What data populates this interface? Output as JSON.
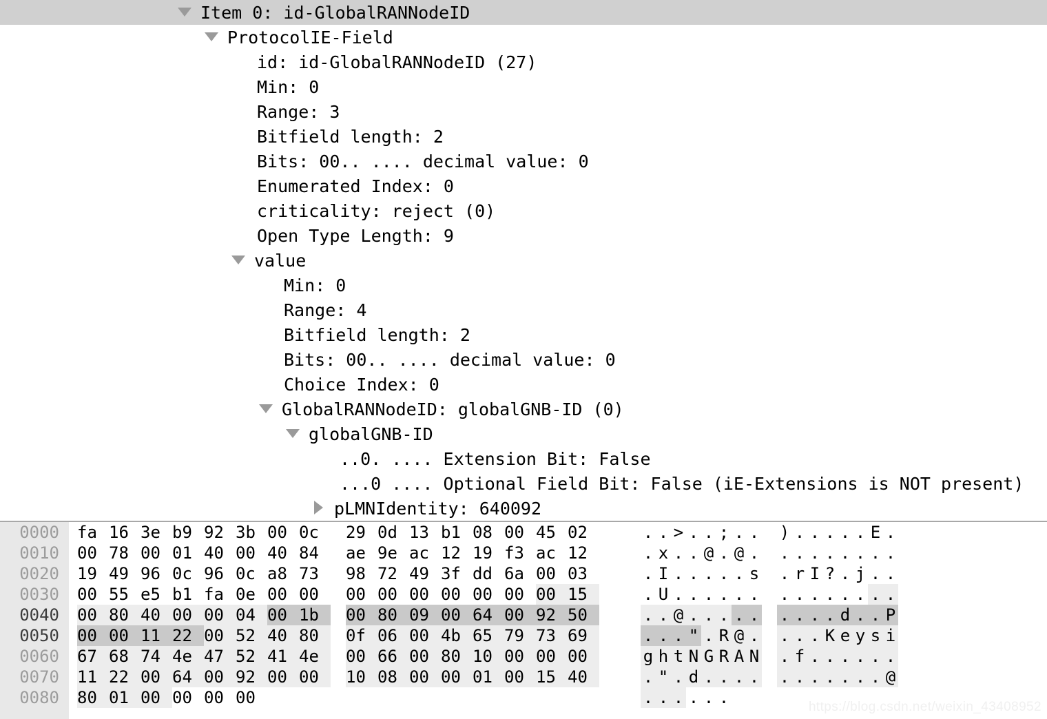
{
  "detail_tree": {
    "rows": [
      {
        "indent": "ind0",
        "twisty": "open",
        "text": "Item 0: id-GlobalRANNodeID",
        "selected": true
      },
      {
        "indent": "ind1",
        "twisty": "open",
        "text": "ProtocolIE-Field",
        "selected": false
      },
      {
        "indent": "ind2",
        "twisty": "none",
        "text": "id: id-GlobalRANNodeID (27)",
        "selected": false
      },
      {
        "indent": "ind2",
        "twisty": "none",
        "text": "Min: 0",
        "selected": false
      },
      {
        "indent": "ind2",
        "twisty": "none",
        "text": "Range: 3",
        "selected": false
      },
      {
        "indent": "ind2",
        "twisty": "none",
        "text": "Bitfield length: 2",
        "selected": false
      },
      {
        "indent": "ind2",
        "twisty": "none",
        "text": "Bits: 00.. .... decimal value: 0",
        "selected": false
      },
      {
        "indent": "ind2",
        "twisty": "none",
        "text": "Enumerated Index: 0",
        "selected": false
      },
      {
        "indent": "ind2",
        "twisty": "none",
        "text": "criticality: reject (0)",
        "selected": false
      },
      {
        "indent": "ind2",
        "twisty": "none",
        "text": "Open Type Length: 9",
        "selected": false
      },
      {
        "indent": "ind3",
        "twisty": "open",
        "text": "value",
        "selected": false
      },
      {
        "indent": "ind4",
        "twisty": "none",
        "text": "Min: 0",
        "selected": false
      },
      {
        "indent": "ind4",
        "twisty": "none",
        "text": "Range: 4",
        "selected": false
      },
      {
        "indent": "ind4",
        "twisty": "none",
        "text": "Bitfield length: 2",
        "selected": false
      },
      {
        "indent": "ind4",
        "twisty": "none",
        "text": "Bits: 00.. .... decimal value: 0",
        "selected": false
      },
      {
        "indent": "ind4",
        "twisty": "none",
        "text": "Choice Index: 0",
        "selected": false
      },
      {
        "indent": "ind5",
        "twisty": "open",
        "text": "GlobalRANNodeID: globalGNB-ID (0)",
        "selected": false
      },
      {
        "indent": "ind6",
        "twisty": "open",
        "text": "globalGNB-ID",
        "selected": false
      },
      {
        "indent": "ind7",
        "twisty": "none",
        "text": "..0. .... Extension Bit: False",
        "selected": false
      },
      {
        "indent": "ind7",
        "twisty": "none",
        "text": "...0 .... Optional Field Bit: False (iE-Extensions is NOT present)",
        "selected": false
      },
      {
        "indent": "ind8",
        "twisty": "closed",
        "text": "pLMNIdentity: 640092",
        "selected": false
      }
    ]
  },
  "hex_dump": {
    "rows": [
      {
        "offset": "0000",
        "offset_highlight": false,
        "bytes": [
          "fa",
          "16",
          "3e",
          "b9",
          "92",
          "3b",
          "00",
          "0c",
          "29",
          "0d",
          "13",
          "b1",
          "08",
          "00",
          "45",
          "02"
        ],
        "ascii": [
          ".",
          ".",
          ">",
          ".",
          ".",
          ";",
          ".",
          ".",
          ")",
          ".",
          ".",
          ".",
          ".",
          ".",
          "E",
          "."
        ],
        "hl_light_from": -1,
        "hl_light_to": -1,
        "hl_dark_from": -1,
        "hl_dark_to": -1
      },
      {
        "offset": "0010",
        "offset_highlight": false,
        "bytes": [
          "00",
          "78",
          "00",
          "01",
          "40",
          "00",
          "40",
          "84",
          "ae",
          "9e",
          "ac",
          "12",
          "19",
          "f3",
          "ac",
          "12"
        ],
        "ascii": [
          ".",
          "x",
          ".",
          ".",
          "@",
          ".",
          "@",
          ".",
          ".",
          ".",
          ".",
          ".",
          ".",
          ".",
          ".",
          "."
        ],
        "hl_light_from": -1,
        "hl_light_to": -1,
        "hl_dark_from": -1,
        "hl_dark_to": -1
      },
      {
        "offset": "0020",
        "offset_highlight": false,
        "bytes": [
          "19",
          "49",
          "96",
          "0c",
          "96",
          "0c",
          "a8",
          "73",
          "98",
          "72",
          "49",
          "3f",
          "dd",
          "6a",
          "00",
          "03"
        ],
        "ascii": [
          ".",
          "I",
          ".",
          ".",
          ".",
          ".",
          ".",
          "s",
          ".",
          "r",
          "I",
          "?",
          ".",
          "j",
          ".",
          "."
        ],
        "hl_light_from": -1,
        "hl_light_to": -1,
        "hl_dark_from": -1,
        "hl_dark_to": -1
      },
      {
        "offset": "0030",
        "offset_highlight": false,
        "bytes": [
          "00",
          "55",
          "e5",
          "b1",
          "fa",
          "0e",
          "00",
          "00",
          "00",
          "00",
          "00",
          "00",
          "00",
          "00",
          "00",
          "15"
        ],
        "ascii": [
          ".",
          "U",
          ".",
          ".",
          ".",
          ".",
          ".",
          ".",
          ".",
          ".",
          ".",
          ".",
          ".",
          ".",
          ".",
          "."
        ],
        "hl_light_from": 14,
        "hl_light_to": 15,
        "hl_dark_from": -1,
        "hl_dark_to": -1
      },
      {
        "offset": "0040",
        "offset_highlight": true,
        "bytes": [
          "00",
          "80",
          "40",
          "00",
          "00",
          "04",
          "00",
          "1b",
          "00",
          "80",
          "09",
          "00",
          "64",
          "00",
          "92",
          "50"
        ],
        "ascii": [
          ".",
          ".",
          "@",
          ".",
          ".",
          ".",
          ".",
          ".",
          ".",
          ".",
          ".",
          ".",
          "d",
          ".",
          ".",
          "P"
        ],
        "hl_light_from": 0,
        "hl_light_to": 15,
        "hl_dark_from": 6,
        "hl_dark_to": 15
      },
      {
        "offset": "0050",
        "offset_highlight": true,
        "bytes": [
          "00",
          "00",
          "11",
          "22",
          "00",
          "52",
          "40",
          "80",
          "0f",
          "06",
          "00",
          "4b",
          "65",
          "79",
          "73",
          "69"
        ],
        "ascii": [
          ".",
          ".",
          ".",
          "\"",
          ".",
          "R",
          "@",
          ".",
          ".",
          ".",
          ".",
          "K",
          "e",
          "y",
          "s",
          "i"
        ],
        "hl_light_from": 0,
        "hl_light_to": 15,
        "hl_dark_from": 0,
        "hl_dark_to": 3
      },
      {
        "offset": "0060",
        "offset_highlight": false,
        "bytes": [
          "67",
          "68",
          "74",
          "4e",
          "47",
          "52",
          "41",
          "4e",
          "00",
          "66",
          "00",
          "80",
          "10",
          "00",
          "00",
          "00"
        ],
        "ascii": [
          "g",
          "h",
          "t",
          "N",
          "G",
          "R",
          "A",
          "N",
          ".",
          "f",
          ".",
          ".",
          ".",
          ".",
          ".",
          "."
        ],
        "hl_light_from": 0,
        "hl_light_to": 15,
        "hl_dark_from": -1,
        "hl_dark_to": -1
      },
      {
        "offset": "0070",
        "offset_highlight": false,
        "bytes": [
          "11",
          "22",
          "00",
          "64",
          "00",
          "92",
          "00",
          "00",
          "10",
          "08",
          "00",
          "00",
          "01",
          "00",
          "15",
          "40"
        ],
        "ascii": [
          ".",
          "\"",
          ".",
          "d",
          ".",
          ".",
          ".",
          ".",
          ".",
          ".",
          ".",
          ".",
          ".",
          ".",
          ".",
          "@"
        ],
        "hl_light_from": 0,
        "hl_light_to": 15,
        "hl_dark_from": -1,
        "hl_dark_to": -1
      },
      {
        "offset": "0080",
        "offset_highlight": false,
        "bytes": [
          "80",
          "01",
          "00",
          "00",
          "00",
          "00"
        ],
        "ascii": [
          ".",
          ".",
          ".",
          ".",
          ".",
          "."
        ],
        "hl_light_from": 0,
        "hl_light_to": 2,
        "hl_dark_from": -1,
        "hl_dark_to": -1
      }
    ]
  },
  "watermark": {
    "text": "https://blog.csdn.net/weixin_43408952"
  },
  "colors": {
    "selection_gray": "#d0d0d0",
    "gutter_gray": "#e8e8e8",
    "highlight_light": "#ededed",
    "highlight_dark": "#c9c9c9",
    "twisty_gray": "#9a9a9a",
    "offset_text": "#9c9c9c"
  }
}
